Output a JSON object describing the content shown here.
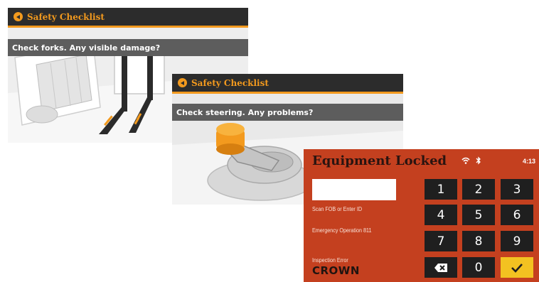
{
  "screen1": {
    "title": "Safety Checklist",
    "question": "Check forks. Any visible damage?",
    "illustration": "forklift-forks"
  },
  "screen2": {
    "title": "Safety Checklist",
    "question": "Check steering. Any problems?",
    "illustration": "steering-tiller"
  },
  "lock_screen": {
    "title": "Equipment Locked",
    "status_icons": [
      "wifi-icon",
      "bluetooth-icon"
    ],
    "clock": "4:13",
    "id_input_value": "",
    "hint_scan": "Scan FOB or Enter ID",
    "hint_emergency": "Emergency Operation 811",
    "hint_inspection": "Inspection Error",
    "logo": "CROWN",
    "keypad": [
      "1",
      "2",
      "3",
      "4",
      "5",
      "6",
      "7",
      "8",
      "9",
      "backspace-icon",
      "0",
      "checkmark-icon"
    ],
    "keypad_labels": {
      "k1": "1",
      "k2": "2",
      "k3": "3",
      "k4": "4",
      "k5": "5",
      "k6": "6",
      "k7": "7",
      "k8": "8",
      "k9": "9",
      "k0": "0"
    },
    "colors": {
      "background": "#c4401f",
      "key": "#1f1f1f",
      "confirm_key": "#f3c221"
    }
  },
  "colors": {
    "accent": "#f39a1e",
    "titlebar": "#2c2c2c",
    "question_bar": "#5d5d5d"
  }
}
